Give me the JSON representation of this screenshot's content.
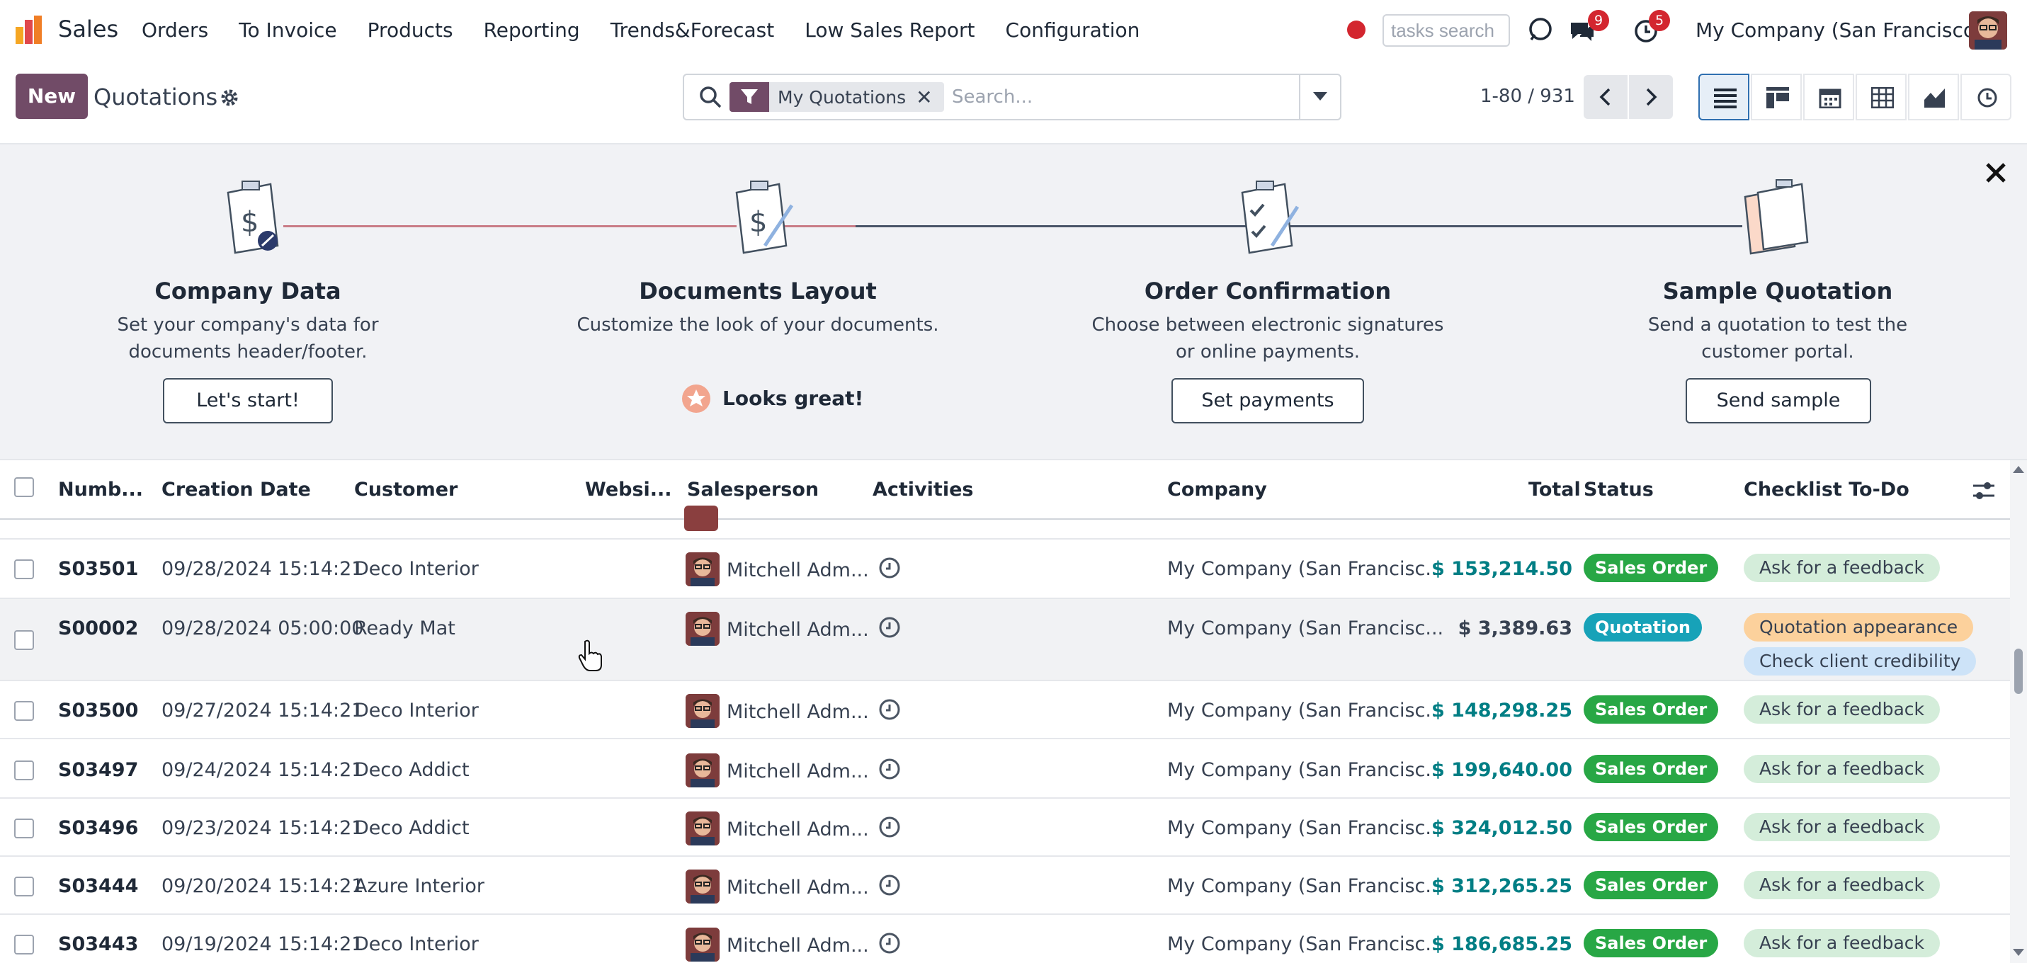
{
  "navbar": {
    "app_name": "Sales",
    "menu": [
      "Orders",
      "To Invoice",
      "Products",
      "Reporting",
      "Trends&Forecast",
      "Low Sales Report",
      "Configuration"
    ],
    "tasks_search_placeholder": "tasks search",
    "messages_count": "9",
    "activities_count": "5",
    "company": "My Company (San Francisco)"
  },
  "control": {
    "new_label": "New",
    "title": "Quotations",
    "facet": "My Quotations",
    "search_placeholder": "Search...",
    "pager": "1-80 / 931"
  },
  "onboarding": {
    "steps": [
      {
        "title": "Company Data",
        "desc": "Set your company's data for documents header/footer.",
        "button": "Let's start!"
      },
      {
        "title": "Documents Layout",
        "desc": "Customize the look of your documents.",
        "done": "Looks great!"
      },
      {
        "title": "Order Confirmation",
        "desc": "Choose between electronic signatures or online payments.",
        "button": "Set payments"
      },
      {
        "title": "Sample Quotation",
        "desc": "Send a quotation to test the customer portal.",
        "button": "Send sample"
      }
    ]
  },
  "table": {
    "headers": [
      "Numb...",
      "Creation Date",
      "Customer",
      "Websi...",
      "Salesperson",
      "Activities",
      "Company",
      "Total",
      "Status",
      "Checklist To-Do"
    ],
    "rows": [
      {
        "number": "S03501",
        "date": "09/28/2024 15:14:21",
        "customer": "Deco Interior",
        "salesperson": "Mitchell Adm...",
        "company": "My Company (San Francisc...",
        "total": "$ 153,214.50",
        "status": "Sales Order",
        "tags": [
          "Ask for a feedback"
        ]
      },
      {
        "number": "S00002",
        "date": "09/28/2024 05:00:00",
        "customer": "Ready Mat",
        "salesperson": "Mitchell Adm...",
        "company": "My Company (San Francisc...",
        "total": "$ 3,389.63",
        "status": "Quotation",
        "tags": [
          "Quotation appearance",
          "Check client credibility"
        ]
      },
      {
        "number": "S03500",
        "date": "09/27/2024 15:14:21",
        "customer": "Deco Interior",
        "salesperson": "Mitchell Adm...",
        "company": "My Company (San Francisc...",
        "total": "$ 148,298.25",
        "status": "Sales Order",
        "tags": [
          "Ask for a feedback"
        ]
      },
      {
        "number": "S03497",
        "date": "09/24/2024 15:14:21",
        "customer": "Deco Addict",
        "salesperson": "Mitchell Adm...",
        "company": "My Company (San Francisc...",
        "total": "$ 199,640.00",
        "status": "Sales Order",
        "tags": [
          "Ask for a feedback"
        ]
      },
      {
        "number": "S03496",
        "date": "09/23/2024 15:14:21",
        "customer": "Deco Addict",
        "salesperson": "Mitchell Adm...",
        "company": "My Company (San Francisc...",
        "total": "$ 324,012.50",
        "status": "Sales Order",
        "tags": [
          "Ask for a feedback"
        ]
      },
      {
        "number": "S03444",
        "date": "09/20/2024 15:14:21",
        "customer": "Azure Interior",
        "salesperson": "Mitchell Adm...",
        "company": "My Company (San Francisc...",
        "total": "$ 312,265.25",
        "status": "Sales Order",
        "tags": [
          "Ask for a feedback"
        ]
      },
      {
        "number": "S03443",
        "date": "09/19/2024 15:14:21",
        "customer": "Deco Interior",
        "salesperson": "Mitchell Adm...",
        "company": "My Company (San Francisc...",
        "total": "$ 186,685.25",
        "status": "Sales Order",
        "tags": [
          "Ask for a feedback"
        ]
      }
    ]
  },
  "colors": {
    "brand": "#714b67",
    "sales_order": "#28a745",
    "quotation": "#17a2b8",
    "total_highlight": "#017e84",
    "tag_green": "#d4edda",
    "tag_orange": "#fcd19c",
    "tag_blue": "#cde3f8"
  }
}
